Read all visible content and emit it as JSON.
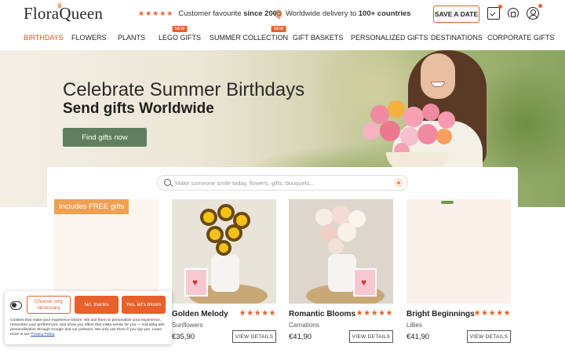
{
  "brand": {
    "name": "FloraQueen"
  },
  "topbar": {
    "stars": "★★★★★",
    "tagline_prefix": "Customer favourite ",
    "tagline_bold": "since 2005",
    "delivery_prefix": "Worldwide delivery to ",
    "delivery_bold": "100+ countries",
    "save_date": "SAVE A DATE"
  },
  "nav": {
    "items": [
      {
        "label": "BIRTHDAYS"
      },
      {
        "label": "FLOWERS"
      },
      {
        "label": "PLANTS"
      },
      {
        "label": "LEGO GIFTS",
        "badge": "NEW"
      },
      {
        "label": "SUMMER COLLECTION",
        "badge": "NEW"
      },
      {
        "label": "GIFT BASKETS"
      },
      {
        "label": "PERSONALIZED GIFTS"
      },
      {
        "label": "DESTINATIONS"
      },
      {
        "label": "CORPORATE GIFTS"
      }
    ]
  },
  "hero": {
    "title": "Celebrate Summer Birthdays",
    "subtitle": "Send gifts Worldwide",
    "button": "Find gifts now"
  },
  "search": {
    "placeholder": "Make someone smile today, flowers, gifts, bouquets..."
  },
  "promo": {
    "badge": "Includes FREE gifts"
  },
  "products": [
    {
      "name": "Golden Melody",
      "category": "Sunflowers",
      "price": "€35,90",
      "rating": "★★★★★",
      "button": "VIEW DETAILS"
    },
    {
      "name": "Romantic Blooms",
      "category": "Carnations",
      "price": "€41,90",
      "rating": "★★★★★",
      "button": "VIEW DETAILS"
    },
    {
      "name": "Bright Beginnings",
      "category": "Lillies",
      "price": "€41,90",
      "rating": "★★★★★",
      "button": "VIEW DETAILS"
    }
  ],
  "cookie": {
    "btn_necessary": "Choose only necessary",
    "btn_no": "No, thanks",
    "btn_yes": "Yes, let's bloom",
    "text": "Cookies that make your experience bloom. We use them to personalize your experience, remember your preferences, and show you offers that make sense for you — including ads personalisation through Google and our partners. We only use them if you say yes. Learn more in our",
    "link": "Privacy Policy"
  },
  "colors": {
    "accent": "#e8602a",
    "hero_button": "#5f7f5f",
    "promo_badge": "#f0a050"
  }
}
